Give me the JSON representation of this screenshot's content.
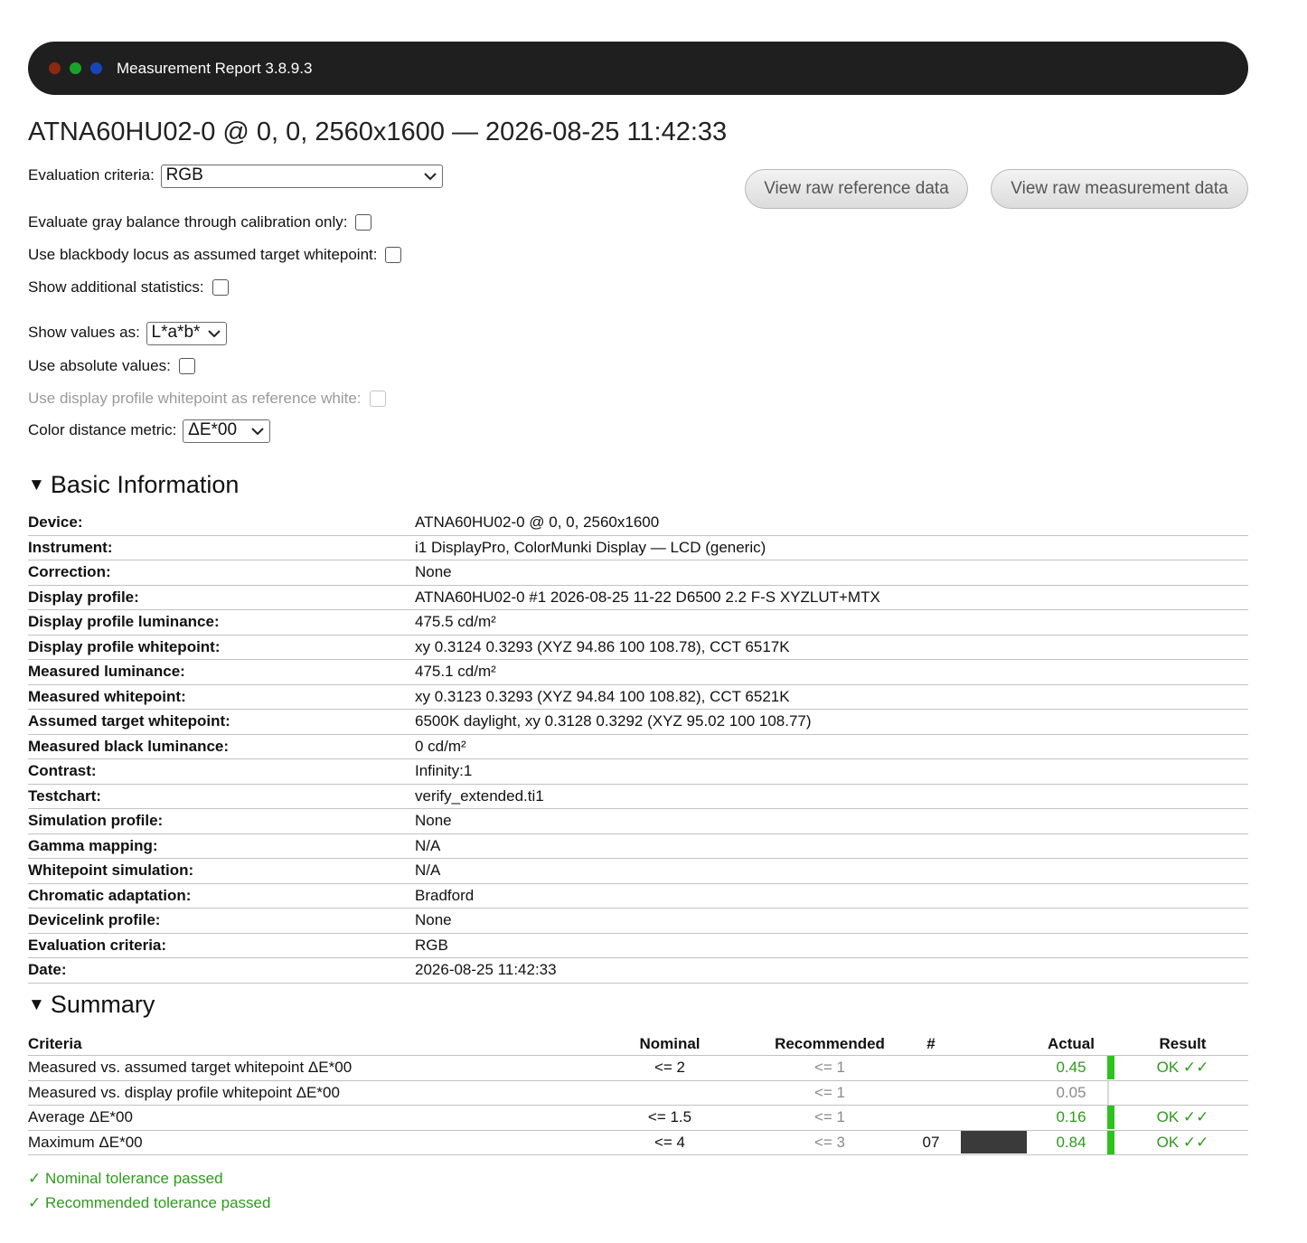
{
  "window": {
    "title": "Measurement Report 3.8.9.3"
  },
  "report_title": "ATNA60HU02-0 @ 0, 0, 2560x1600 — 2026-08-25 11:42:33",
  "controls": {
    "evaluation_criteria": {
      "label": "Evaluation criteria:",
      "value": "RGB"
    },
    "gray_balance": {
      "label": "Evaluate gray balance through calibration only:",
      "checked": false
    },
    "blackbody": {
      "label": "Use blackbody locus as assumed target whitepoint:",
      "checked": false
    },
    "additional_stats": {
      "label": "Show additional statistics:",
      "checked": false
    },
    "show_values_as": {
      "label": "Show values as:",
      "value": "L*a*b*"
    },
    "absolute_values": {
      "label": "Use absolute values:",
      "checked": false
    },
    "profile_whitepoint": {
      "label": "Use display profile whitepoint as reference white:",
      "checked": false,
      "disabled": true
    },
    "color_distance": {
      "label": "Color distance metric:",
      "value": "ΔE*00"
    }
  },
  "buttons": {
    "raw_reference": "View raw reference data",
    "raw_measurement": "View raw measurement data"
  },
  "basic_info": {
    "heading": "Basic Information",
    "rows": [
      {
        "key": "Device:",
        "value": "ATNA60HU02-0 @ 0, 0, 2560x1600"
      },
      {
        "key": "Instrument:",
        "value": "i1 DisplayPro, ColorMunki Display — LCD (generic)"
      },
      {
        "key": "Correction:",
        "value": "None"
      },
      {
        "key": "Display profile:",
        "value": "ATNA60HU02-0 #1 2026-08-25 11-22 D6500 2.2 F-S XYZLUT+MTX"
      },
      {
        "key": "Display profile luminance:",
        "value": "475.5 cd/m²"
      },
      {
        "key": "Display profile whitepoint:",
        "value": "xy 0.3124 0.3293 (XYZ 94.86 100 108.78), CCT 6517K"
      },
      {
        "key": "Measured luminance:",
        "value": "475.1 cd/m²"
      },
      {
        "key": "Measured whitepoint:",
        "value": "xy 0.3123 0.3293 (XYZ 94.84 100 108.82), CCT 6521K"
      },
      {
        "key": "Assumed target whitepoint:",
        "value": "6500K daylight, xy 0.3128 0.3292 (XYZ 95.02 100 108.77)"
      },
      {
        "key": "Measured black luminance:",
        "value": "0 cd/m²"
      },
      {
        "key": "Contrast:",
        "value": "Infinity:1"
      },
      {
        "key": "Testchart:",
        "value": "verify_extended.ti1"
      },
      {
        "key": "Simulation profile:",
        "value": "None"
      },
      {
        "key": "Gamma mapping:",
        "value": "N/A"
      },
      {
        "key": "Whitepoint simulation:",
        "value": "N/A"
      },
      {
        "key": "Chromatic adaptation:",
        "value": "Bradford"
      },
      {
        "key": "Devicelink profile:",
        "value": "None"
      },
      {
        "key": "Evaluation criteria:",
        "value": "RGB"
      },
      {
        "key": "Date:",
        "value": "2026-08-25 11:42:33"
      }
    ]
  },
  "summary": {
    "heading": "Summary",
    "columns": {
      "criteria": "Criteria",
      "nominal": "Nominal",
      "recommended": "Recommended",
      "number": "#",
      "actual": "Actual",
      "result": "Result"
    },
    "rows": [
      {
        "criteria": "Measured vs. assumed target whitepoint ΔE*00",
        "nominal": "<= 2",
        "recommended": "<= 1",
        "number": "",
        "actual": "0.45",
        "result": "OK ✓✓",
        "status": "ok"
      },
      {
        "criteria": "Measured vs. display profile whitepoint ΔE*00",
        "nominal": "",
        "recommended": "<= 1",
        "number": "",
        "actual": "0.05",
        "result": "",
        "status": "none"
      },
      {
        "criteria": "Average ΔE*00",
        "nominal": "<= 1.5",
        "recommended": "<= 1",
        "number": "",
        "actual": "0.16",
        "result": "OK ✓✓",
        "status": "ok"
      },
      {
        "criteria": "Maximum ΔE*00",
        "nominal": "<= 4",
        "recommended": "<= 3",
        "number": "07",
        "actual": "0.84",
        "result": "OK ✓✓",
        "status": "ok",
        "swatch_color": "#3a3a3a"
      }
    ]
  },
  "results": {
    "nominal": "✓ Nominal tolerance passed",
    "recommended": "✓ Recommended tolerance passed"
  },
  "colors": {
    "pass_green": "#2f9a1e",
    "bar_green": "#2ec21f",
    "titlebar": "#1f1f1f"
  }
}
